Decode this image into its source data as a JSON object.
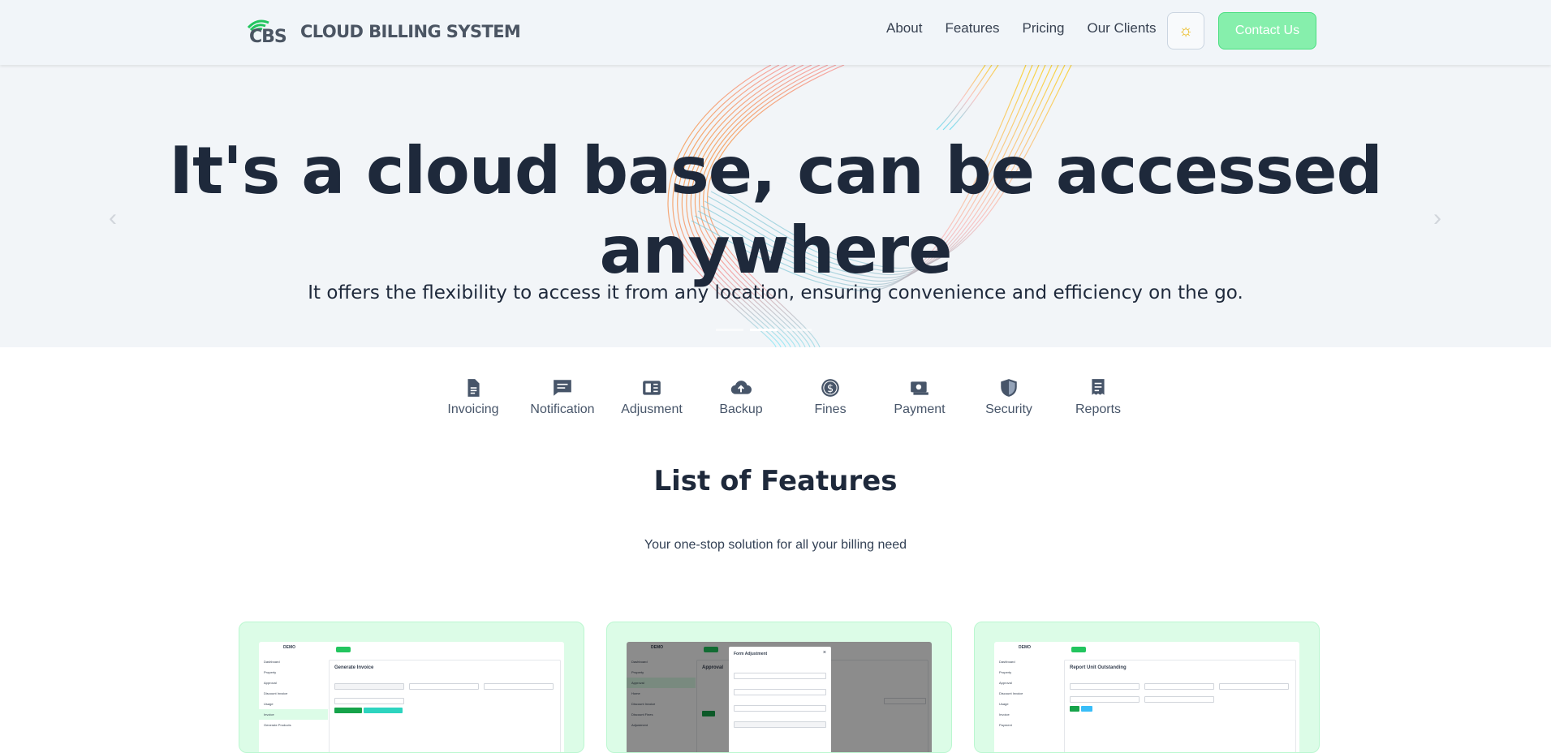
{
  "navbar": {
    "logo_mark": "CBS",
    "logo_name": "CLOUD BILLING SYSTEM",
    "links": [
      "About",
      "Features",
      "Pricing",
      "Our Clients"
    ],
    "theme_icon": "sun-icon",
    "contact_label": "Contact Us"
  },
  "hero": {
    "title": "It's a cloud base, can be accessed anywhere",
    "subtitle": "It offers the flexibility to access it from any location, ensuring convenience and efficiency on the go.",
    "prev_icon": "chevron-left-icon",
    "next_icon": "chevron-right-icon",
    "active_slide": 2,
    "slide_count": 3
  },
  "features_nav": [
    {
      "label": "Invoicing",
      "icon": "document-icon"
    },
    {
      "label": "Notification",
      "icon": "message-icon"
    },
    {
      "label": "Adjusment",
      "icon": "newspaper-icon"
    },
    {
      "label": "Backup",
      "icon": "cloud-upload-icon"
    },
    {
      "label": "Fines",
      "icon": "dollar-circle-icon"
    },
    {
      "label": "Payment",
      "icon": "cash-icon"
    },
    {
      "label": "Security",
      "icon": "shield-icon"
    },
    {
      "label": "Reports",
      "icon": "receipt-icon"
    }
  ],
  "section": {
    "title": "List of Features",
    "subtitle": "Your one-stop solution for all your billing need"
  },
  "cards": [
    {
      "brand": "DEMO",
      "panel_title": "Generate Invoice",
      "side": [
        "Dashboard",
        "Property",
        "Approval",
        "Discount Invoice",
        "Usage",
        "Invoice",
        "Generate Products"
      ]
    },
    {
      "brand": "DEMO",
      "panel_title": "Approval",
      "modal_title": "Form Adjustment",
      "side": [
        "Dashboard",
        "Property",
        "Approval",
        "Home",
        "Discount Invoice",
        "Discount Fines",
        "Adjustment"
      ]
    },
    {
      "brand": "DEMO",
      "panel_title": "Report Unit Outstanding",
      "side": [
        "Dashboard",
        "Property",
        "Approval",
        "Discount Invoice",
        "Usage",
        "Invoice",
        "Payment"
      ]
    }
  ],
  "colors": {
    "accent": "#86efac",
    "text": "#1e293b",
    "hero_bg": "#f2f5f8",
    "card_bg": "#dcfce7"
  }
}
